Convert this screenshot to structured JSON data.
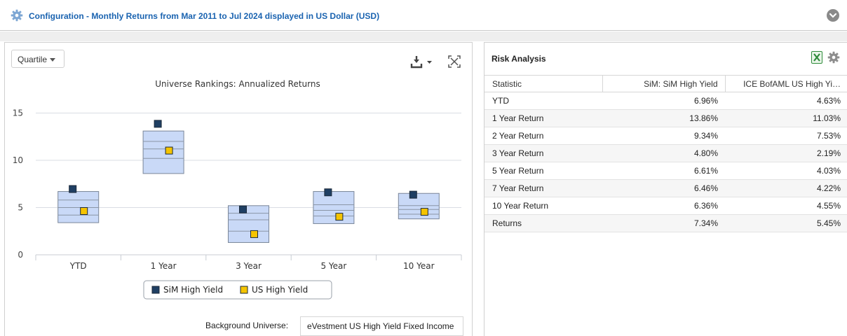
{
  "header": {
    "title": "Configuration - Monthly Returns from Mar 2011 to Jul 2024 displayed in US Dollar (USD)",
    "gear_icon": "gear-icon",
    "collapse_icon": "chevron-down-circle-icon"
  },
  "left_panel": {
    "view_select": "Quartile",
    "download_icon": "download-icon",
    "expand_icon": "expand-icon",
    "background_universe_label": "Background Universe:",
    "background_universe_value": "eVestment US High Yield Fixed Income"
  },
  "chart_data": {
    "type": "box",
    "title": "Universe Rankings: Annualized Returns",
    "xlabel": "",
    "ylabel": "",
    "categories": [
      "YTD",
      "1 Year",
      "3 Year",
      "5 Year",
      "10 Year"
    ],
    "ylim": [
      0,
      16
    ],
    "yticks": [
      0,
      5,
      10,
      15
    ],
    "grid": true,
    "legend": "bottom",
    "boxes": [
      {
        "q5": 3.4,
        "q25": 4.2,
        "median": 5.0,
        "q75": 5.8,
        "q95": 6.7
      },
      {
        "q5": 8.6,
        "q25": 10.2,
        "median": 11.2,
        "q75": 12.0,
        "q95": 13.1
      },
      {
        "q5": 1.3,
        "q25": 2.5,
        "median": 3.7,
        "q75": 4.4,
        "q95": 5.2
      },
      {
        "q5": 3.3,
        "q25": 4.1,
        "median": 4.7,
        "q75": 5.3,
        "q95": 6.7
      },
      {
        "q5": 3.8,
        "q25": 4.3,
        "median": 4.8,
        "q75": 5.2,
        "q95": 6.5
      }
    ],
    "series": [
      {
        "name": "SiM High Yield",
        "color": "#1f3f63",
        "values": [
          6.96,
          13.86,
          4.8,
          6.61,
          6.36
        ]
      },
      {
        "name": "US High Yield",
        "color": "#f5c400",
        "values": [
          4.63,
          11.03,
          2.19,
          4.03,
          4.55
        ]
      }
    ],
    "box_color": "#c9d9f7"
  },
  "risk_analysis": {
    "title": "Risk Analysis",
    "excel_icon": "excel-icon",
    "gear_icon": "gear-icon",
    "columns": [
      "Statistic",
      "SiM: SiM High Yield",
      "ICE BofAML US High Yi…"
    ],
    "rows": [
      [
        "YTD",
        "6.96%",
        "4.63%"
      ],
      [
        "1 Year Return",
        "13.86%",
        "11.03%"
      ],
      [
        "2 Year Return",
        "9.34%",
        "7.53%"
      ],
      [
        "3 Year Return",
        "4.80%",
        "2.19%"
      ],
      [
        "5 Year Return",
        "6.61%",
        "4.03%"
      ],
      [
        "7 Year Return",
        "6.46%",
        "4.22%"
      ],
      [
        "10 Year Return",
        "6.36%",
        "4.55%"
      ],
      [
        "Returns",
        "7.34%",
        "5.45%"
      ]
    ]
  }
}
